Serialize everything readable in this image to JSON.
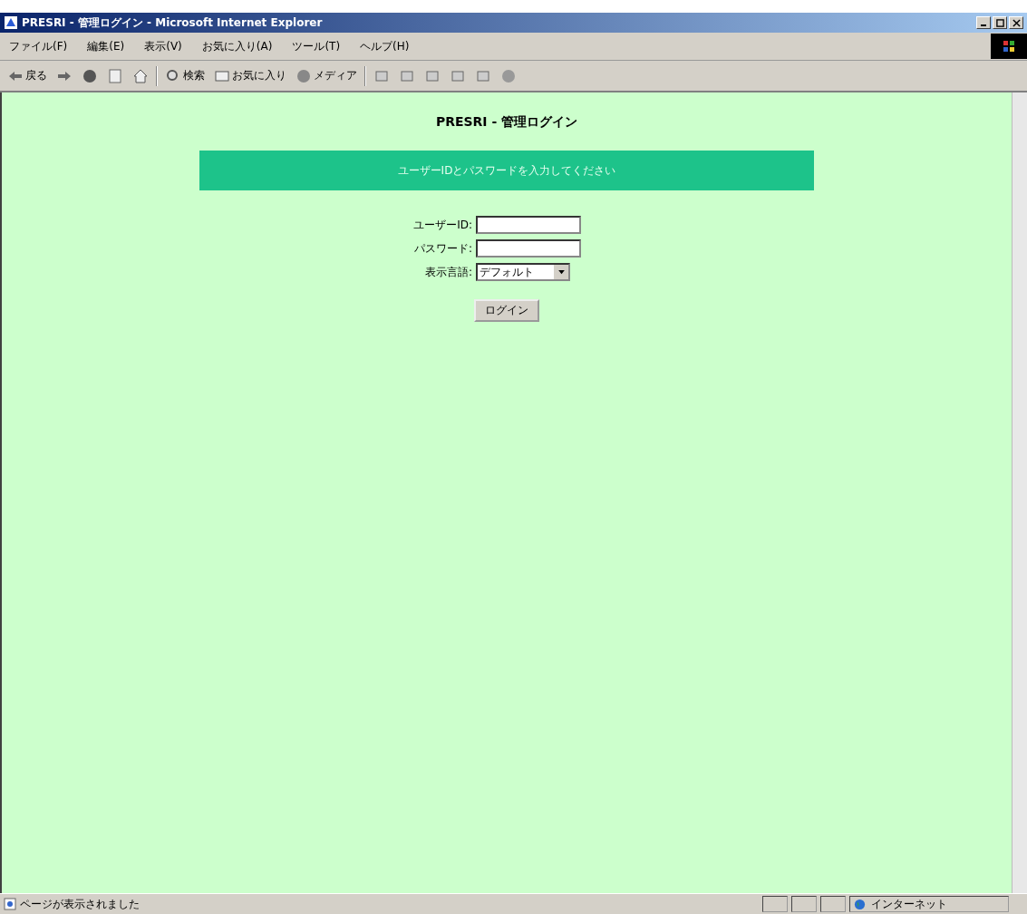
{
  "window": {
    "title": "PRESRI - 管理ログイン - Microsoft Internet Explorer"
  },
  "menu": [
    "ファイル(F)",
    "編集(E)",
    "表示(V)",
    "お気に入り(A)",
    "ツール(T)",
    "ヘルプ(H)"
  ],
  "toolbar": [
    {
      "kind": "back",
      "label": "戻る"
    },
    {
      "kind": "forward"
    },
    {
      "kind": "stop"
    },
    {
      "kind": "refresh"
    },
    {
      "kind": "home"
    },
    {
      "kind": "sep"
    },
    {
      "kind": "search",
      "label": "検索"
    },
    {
      "kind": "favorites",
      "label": "お気に入り"
    },
    {
      "kind": "media",
      "label": "メディア"
    },
    {
      "kind": "sep"
    },
    {
      "kind": "history"
    },
    {
      "kind": "mail"
    },
    {
      "kind": "print"
    },
    {
      "kind": "edit"
    },
    {
      "kind": "discuss"
    },
    {
      "kind": "messenger"
    }
  ],
  "page": {
    "title": "PRESRI - 管理ログイン",
    "banner": "ユーザーIDとパスワードを入力してください",
    "fields": [
      {
        "kind": "text",
        "label": "ユーザーID:"
      },
      {
        "kind": "password",
        "label": "パスワード:"
      },
      {
        "kind": "select",
        "label": "表示言語:",
        "value": "デフォルト"
      }
    ],
    "button": "ログイン"
  },
  "status_bar": {
    "text": "ページが表示されました",
    "zone": "インターネット"
  }
}
